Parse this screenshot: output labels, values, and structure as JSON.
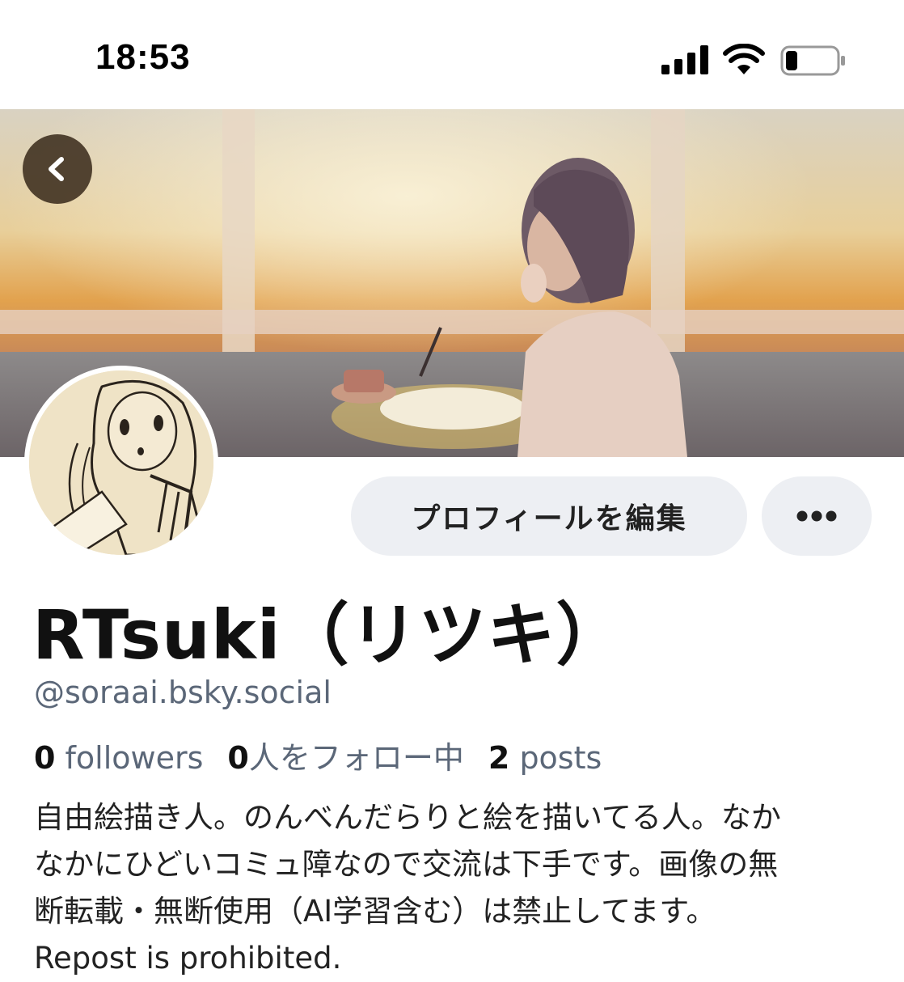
{
  "status_bar": {
    "time": "18:53"
  },
  "profile": {
    "display_name": "RTsuki（リツキ）",
    "handle": "@soraai.bsky.social",
    "edit_label": "プロフィールを編集",
    "stats": {
      "followers_count": "0",
      "followers_label": "followers",
      "following_count": "0",
      "following_label": "人をフォロー中",
      "posts_count": "2",
      "posts_label": "posts"
    },
    "bio_lines": [
      "自由絵描き人。のんべんだらりと絵を描いてる人。なか",
      "なかにひどいコミュ障なので交流は下手です。画像の無",
      "断転載・無断使用（AI学習含む）は禁止してます。",
      "Repost is prohibited."
    ]
  },
  "icons": {
    "back": "chevron-left-icon",
    "more": "ellipsis-icon",
    "signal": "cellular-signal-icon",
    "wifi": "wifi-icon",
    "battery": "battery-icon"
  },
  "colors": {
    "button_bg": "#edeff3",
    "handle_text": "#5b6778",
    "back_button_bg": "#3c2d1e"
  }
}
